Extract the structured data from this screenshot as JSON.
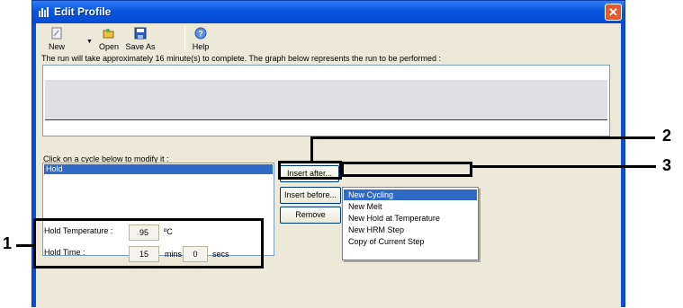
{
  "window": {
    "title": "Edit Profile",
    "close_label": "✕"
  },
  "toolbar": {
    "new_label": "New",
    "open_label": "Open",
    "save_as_label": "Save As",
    "help_label": "Help",
    "dropdown_arrow": "▼"
  },
  "info_text": "The run will take approximately 16 minute(s) to complete. The graph below represents the run to be performed :",
  "cycles": {
    "label": "Click on a cycle below to modify it :",
    "items": [
      "Hold"
    ]
  },
  "buttons": {
    "insert_after": "Insert after...",
    "insert_before": "Insert before...",
    "remove": "Remove"
  },
  "insert_menu": {
    "items": [
      "New Cycling",
      "New Melt",
      "New Hold at Temperature",
      "New HRM Step",
      "Copy of Current Step"
    ],
    "selected": "New Cycling"
  },
  "hold": {
    "temp_label": "Hold Temperature :",
    "temp_value": "95",
    "temp_unit": "ºC",
    "time_label": "Hold Time :",
    "time_mins": "15",
    "mins_unit": "mins",
    "time_secs": "0",
    "secs_unit": "secs"
  },
  "annotations": {
    "n1": "1",
    "n2": "2",
    "n3": "3"
  },
  "colors": {
    "titlebar": "#0a55df",
    "selection": "#316ac5",
    "graph_line": "#c00000"
  }
}
